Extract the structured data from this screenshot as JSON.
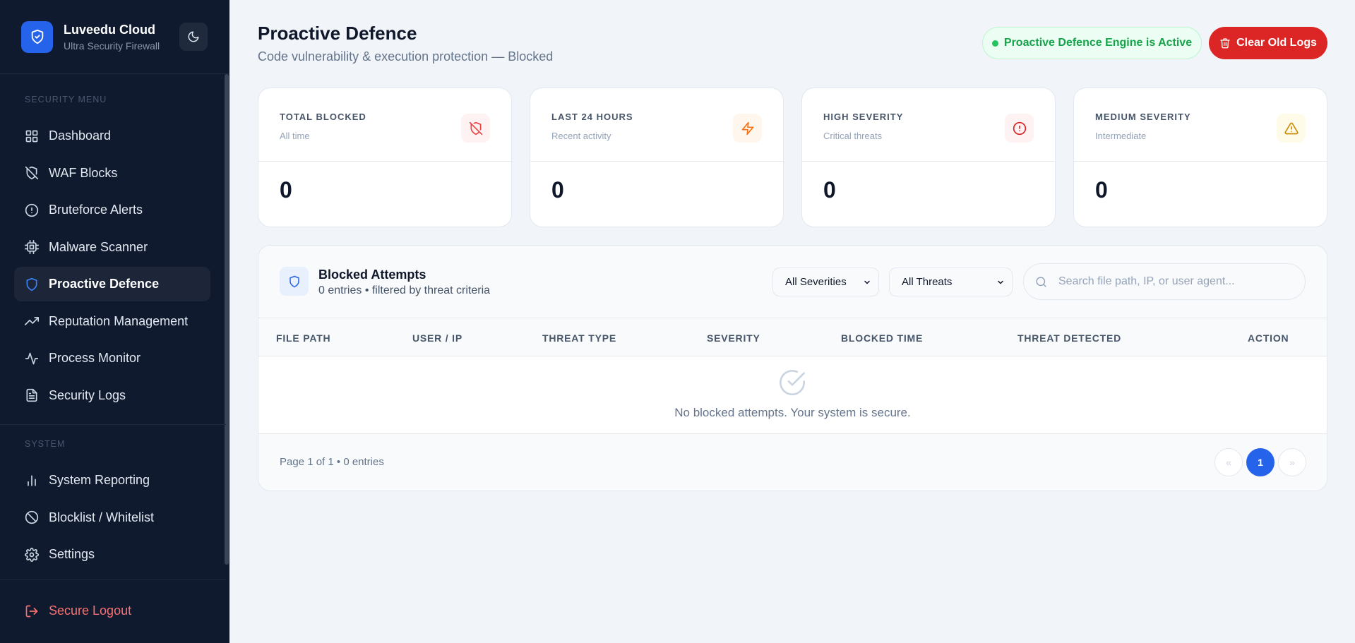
{
  "brand": {
    "name": "Luveedu Cloud",
    "subtitle": "Ultra Security Firewall",
    "logo_icon": "shield-check-icon",
    "theme_icon": "moon-icon"
  },
  "sidebar": {
    "section1_label": "SECURITY MENU",
    "items": [
      {
        "label": "Dashboard",
        "icon": "grid-icon"
      },
      {
        "label": "WAF Blocks",
        "icon": "shield-off-icon"
      },
      {
        "label": "Bruteforce Alerts",
        "icon": "alert-circle-icon"
      },
      {
        "label": "Malware Scanner",
        "icon": "cpu-icon"
      },
      {
        "label": "Proactive Defence",
        "icon": "shield-icon",
        "active": true
      },
      {
        "label": "Reputation Management",
        "icon": "trending-up-icon"
      },
      {
        "label": "Process Monitor",
        "icon": "activity-icon"
      },
      {
        "label": "Security Logs",
        "icon": "file-text-icon"
      }
    ],
    "section2_label": "SYSTEM",
    "system_items": [
      {
        "label": "System Reporting",
        "icon": "bar-chart-icon"
      },
      {
        "label": "Blocklist / Whitelist",
        "icon": "ban-icon"
      },
      {
        "label": "Settings",
        "icon": "gear-icon"
      }
    ],
    "logout_label": "Secure Logout"
  },
  "header": {
    "title": "Proactive Defence",
    "subtitle": "Code vulnerability & execution protection — Blocked",
    "status": "Proactive Defence Engine is Active",
    "clear_button": "Clear Old Logs"
  },
  "stats": [
    {
      "label": "TOTAL BLOCKED",
      "desc": "All time",
      "value": "0",
      "icon": "shield-off-icon",
      "color": "#ef4444"
    },
    {
      "label": "LAST 24 HOURS",
      "desc": "Recent activity",
      "value": "0",
      "icon": "zap-icon",
      "color": "#f97316"
    },
    {
      "label": "HIGH SEVERITY",
      "desc": "Critical threats",
      "value": "0",
      "icon": "alert-circle-icon",
      "color": "#dc2626"
    },
    {
      "label": "MEDIUM SEVERITY",
      "desc": "Intermediate",
      "value": "0",
      "icon": "alert-triangle-icon",
      "color": "#eab308"
    }
  ],
  "panel": {
    "title": "Blocked Attempts",
    "subtitle": "0 entries • filtered by threat criteria",
    "filter_severity": "All Severities",
    "filter_threat": "All Threats",
    "search_placeholder": "Search file path, IP, or user agent...",
    "columns": [
      "FILE PATH",
      "USER / IP",
      "THREAT TYPE",
      "SEVERITY",
      "BLOCKED TIME",
      "THREAT DETECTED",
      "ACTION"
    ],
    "empty_text": "No blocked attempts. Your system is secure.",
    "footer": "Page 1 of 1 • 0 entries",
    "pagination": {
      "prev": "«",
      "current": "1",
      "next": "»"
    }
  }
}
